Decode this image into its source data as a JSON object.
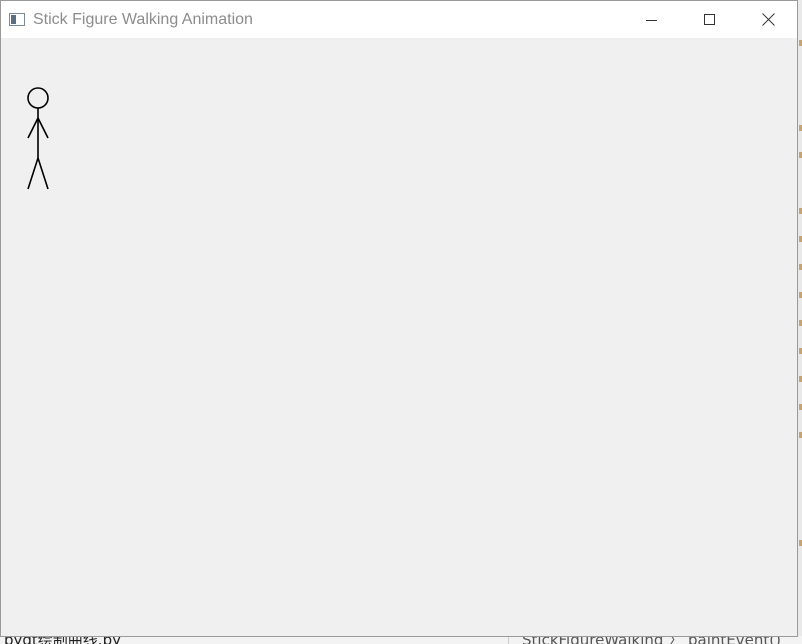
{
  "window": {
    "title": "Stick Figure Walking Animation",
    "icon": "app-window-icon",
    "controls": {
      "minimize": "minimize-icon",
      "maximize": "maximize-icon",
      "close": "close-icon"
    }
  },
  "canvas": {
    "background": "#f0f0f0",
    "figure": {
      "name": "stick-figure",
      "stroke": "#000000"
    }
  },
  "background_windows": {
    "file_tab": "pyqt绘制曲线.py",
    "breadcrumb": [
      "StickFigureWalking",
      "paintEvent()"
    ]
  },
  "colors": {
    "titlebar": "#ffffff",
    "title_text": "#8c8c8c",
    "client": "#f0f0f0"
  }
}
